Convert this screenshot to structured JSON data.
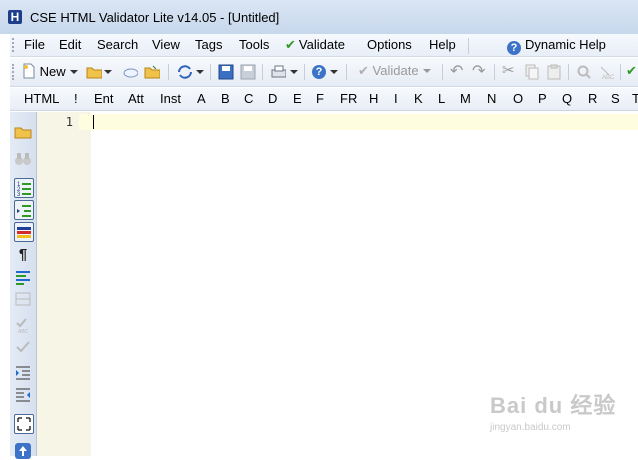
{
  "window": {
    "title": "CSE HTML Validator Lite v14.05 - [Untitled]"
  },
  "menu": [
    {
      "label": "File"
    },
    {
      "label": "Edit"
    },
    {
      "label": "Search"
    },
    {
      "label": "View"
    },
    {
      "label": "Tags"
    },
    {
      "label": "Tools"
    },
    {
      "label": "Validate"
    },
    {
      "label": "Options"
    },
    {
      "label": "Help"
    },
    {
      "label": "Dynamic Help"
    }
  ],
  "toolbar": {
    "new_label": "New",
    "validate_label": "Validate"
  },
  "tags": [
    "HTML",
    "!",
    "Ent",
    "Att",
    "Inst",
    "A",
    "B",
    "C",
    "D",
    "E",
    "F",
    "FR",
    "H",
    "I",
    "K",
    "L",
    "M",
    "N",
    "O",
    "P",
    "Q",
    "R",
    "S",
    "T"
  ],
  "editor": {
    "line_number": "1",
    "content": ""
  },
  "watermark": {
    "brand": "Bai du 经验",
    "url": "jingyan.baidu.com"
  }
}
